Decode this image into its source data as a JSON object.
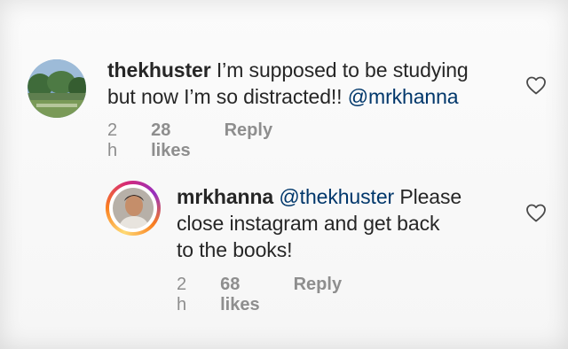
{
  "comments": [
    {
      "username": "thekhuster",
      "text_line1": "I’m supposed to be studying",
      "text_line2_plain": "but now I’m so distracted!! ",
      "text_line2_mention": "@mrkhanna",
      "time": "2 h",
      "likes": "28 likes",
      "reply_label": "Reply"
    },
    {
      "username": "mrkhanna",
      "mention": "@thekhuster",
      "text_line1_rest": " Please",
      "text_line2": "close instagram and get back",
      "text_line3": "to the books!",
      "time": "2 h",
      "likes": "68 likes",
      "reply_label": "Reply"
    }
  ],
  "icons": {
    "like": "heart-outline-icon"
  }
}
